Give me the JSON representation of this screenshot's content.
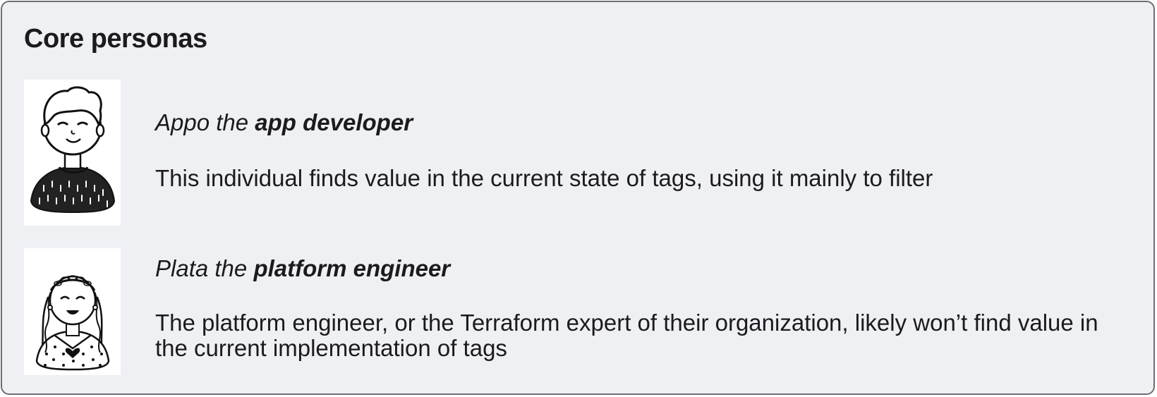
{
  "title": "Core personas",
  "personas": [
    {
      "name_prefix": "Appo the",
      "role": "app developer",
      "description": "This individual finds value in the current state of tags, using it mainly to filter"
    },
    {
      "name_prefix": "Plata the",
      "role": "platform engineer",
      "description": "The platform engineer, or the Terraform expert of their organization, likely won’t find value in the current implementation of tags"
    }
  ]
}
